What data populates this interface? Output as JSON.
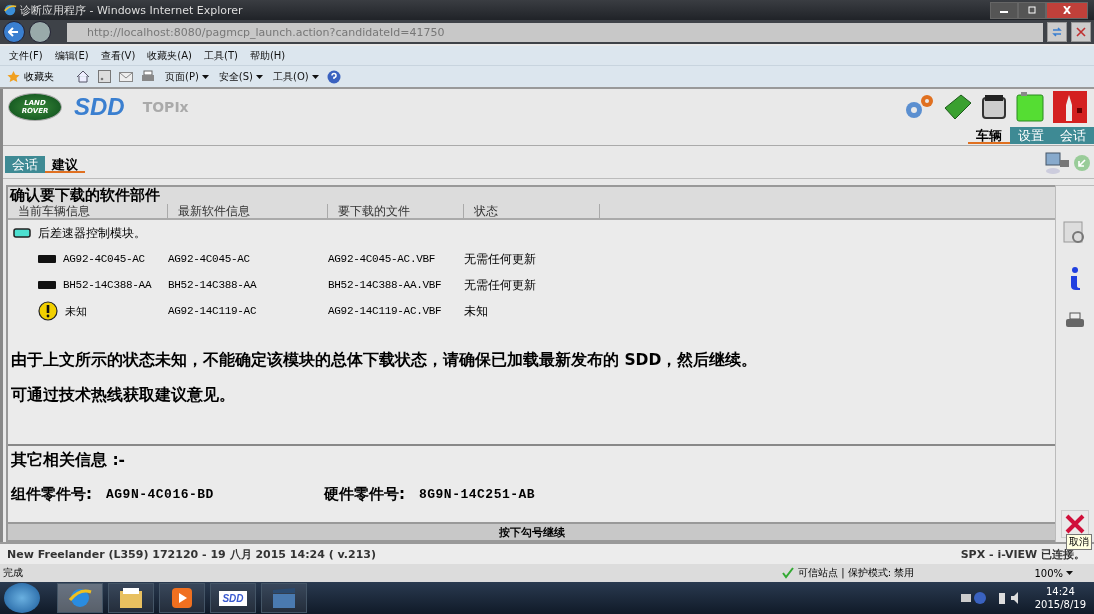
{
  "window": {
    "title": "诊断应用程序 - Windows Internet Explorer"
  },
  "address_bar": {
    "url": "http://localhost:8080/pagmcp_launch.action?candidateId=41750"
  },
  "menu": [
    "文件(F)",
    "编辑(E)",
    "查看(V)",
    "收藏夹(A)",
    "工具(T)",
    "帮助(H)"
  ],
  "favorites_bar": {
    "favorites": "收藏夹",
    "tools": [
      "页面(P)",
      "安全(S)",
      "工具(O)"
    ]
  },
  "app": {
    "logo_text": [
      "LAND",
      "ROVER"
    ],
    "brand": "SDD",
    "product": "TOPIx"
  },
  "top_tabs": [
    {
      "label": "车辆",
      "selected": true
    },
    {
      "label": "设置",
      "selected": false
    },
    {
      "label": "会话",
      "selected": false
    }
  ],
  "sub_tabs": [
    {
      "label": "会话",
      "selected": false
    },
    {
      "label": "建议",
      "selected": true
    }
  ],
  "panel": {
    "title": "确认要下载的软件部件",
    "columns": [
      "当前车辆信息",
      "最新软件信息",
      "要下载的文件",
      "状态"
    ],
    "module": "后差速器控制模块。",
    "rows": [
      {
        "kind": "ok",
        "current": "AG92-4C045-AC",
        "latest": "AG92-4C045-AC",
        "file": "AG92-4C045-AC.VBF",
        "status": "无需任何更新"
      },
      {
        "kind": "ok",
        "current": "BH52-14C388-AA",
        "latest": "BH52-14C388-AA",
        "file": "BH52-14C388-AA.VBF",
        "status": "无需任何更新"
      },
      {
        "kind": "warning",
        "current": "未知",
        "latest": "AG92-14C119-AC",
        "file": "AG92-14C119-AC.VBF",
        "status": "未知"
      }
    ],
    "message": "由于上文所示的状态未知，不能确定该模块的总体下载状态，请确保已加载最新发布的 SDD，然后继续。",
    "hint": "可通过技术热线获取建议意见。",
    "other_title": "其它相关信息 :-",
    "fields": [
      {
        "label": "组件零件号:",
        "value": "AG9N-4C016-BD"
      },
      {
        "label": "硬件零件号:",
        "value": "8G9N-14C251-AB"
      }
    ],
    "continue": "按下勾号继续"
  },
  "tooltip": "取消",
  "app_status": {
    "left": "New Freelander (L359) 172120 - 19 八月 2015 14:24 ( v.213)",
    "right": "SPX - i-VIEW 已连接。"
  },
  "ie_status": {
    "left": "完成",
    "zone": "可信站点 | 保护模式: 禁用",
    "zoom": "100%"
  },
  "taskbar": {
    "apps": [
      {
        "kind": "ie",
        "selected": true
      },
      {
        "kind": "folder",
        "selected": false
      },
      {
        "kind": "media",
        "selected": false
      },
      {
        "kind": "sdd",
        "label": "SDD",
        "selected": false
      },
      {
        "kind": "video",
        "selected": false
      }
    ],
    "time": "14:24",
    "date": "2015/8/19"
  }
}
